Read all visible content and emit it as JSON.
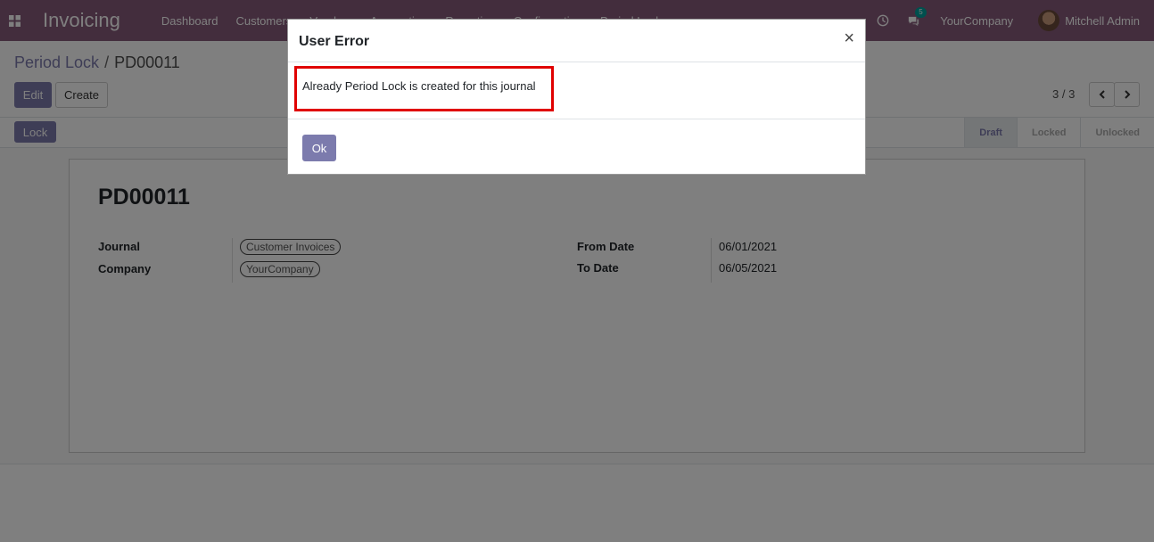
{
  "navbar": {
    "brand": "Invoicing",
    "menu": [
      "Dashboard",
      "Customers",
      "Vendors",
      "Accounting",
      "Reporting",
      "Configuration",
      "Period Lock"
    ],
    "chat_badge": "5",
    "company": "YourCompany",
    "user": "Mitchell Admin",
    "color": "#875a7b"
  },
  "breadcrumb": {
    "parent": "Period Lock",
    "separator": "/",
    "current": "PD00011"
  },
  "actions": {
    "edit": "Edit",
    "create": "Create"
  },
  "pager": {
    "value": "3 / 3"
  },
  "statusbar": {
    "lock_label": "Lock",
    "stages": [
      "Draft",
      "Locked",
      "Unlocked"
    ],
    "active_stage": "Draft"
  },
  "record": {
    "title": "PD00011",
    "journal_label": "Journal",
    "journal_value": "Customer Invoices",
    "company_label": "Company",
    "company_value": "YourCompany",
    "from_date_label": "From Date",
    "from_date_value": "06/01/2021",
    "to_date_label": "To Date",
    "to_date_value": "06/05/2021"
  },
  "dialog": {
    "title": "User Error",
    "close": "×",
    "message": "Already Period Lock is created for this journal",
    "ok_label": "Ok",
    "highlight_color": "#e00000"
  },
  "colors": {
    "primary": "#7c7bad"
  }
}
